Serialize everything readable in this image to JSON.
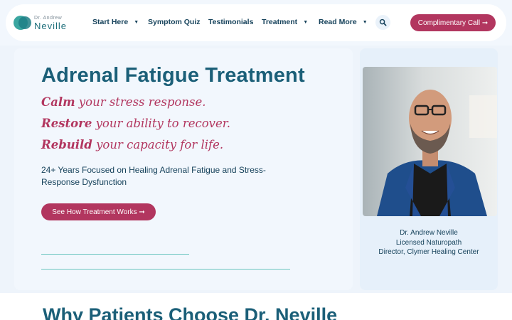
{
  "brand": {
    "small": "Dr. Andrew",
    "big": "Neville"
  },
  "nav": {
    "items": [
      {
        "label": "Start Here",
        "dropdown": true
      },
      {
        "label": "Symptom Quiz",
        "dropdown": false
      },
      {
        "label": "Testimonials",
        "dropdown": false
      },
      {
        "label": "Treatment",
        "dropdown": true
      },
      {
        "label": "Read More",
        "dropdown": true
      }
    ],
    "search_icon": "search-icon",
    "cta": "Complimentary Call ➞"
  },
  "hero": {
    "title": "Adrenal Fatigue Treatment",
    "taglines": [
      {
        "bold": "Calm",
        "rest": " your stress response."
      },
      {
        "bold": "Restore",
        "rest": " your ability to recover."
      },
      {
        "bold": "Rebuild",
        "rest": " your capacity for life."
      }
    ],
    "subhead": "24+ Years Focused on Healing Adrenal Fatigue and Stress-Response Dysfunction",
    "cta": "See How Treatment Works ➞"
  },
  "profile": {
    "name": "Dr. Andrew Neville",
    "role": "Licensed Naturopath",
    "org": "Director, Clymer Healing Center"
  },
  "section": {
    "title": "Why Patients Choose Dr. Neville"
  },
  "colors": {
    "accent": "#b2365f",
    "heading": "#1b5f78",
    "text": "#16425b",
    "teal": "#3aa6a0"
  }
}
